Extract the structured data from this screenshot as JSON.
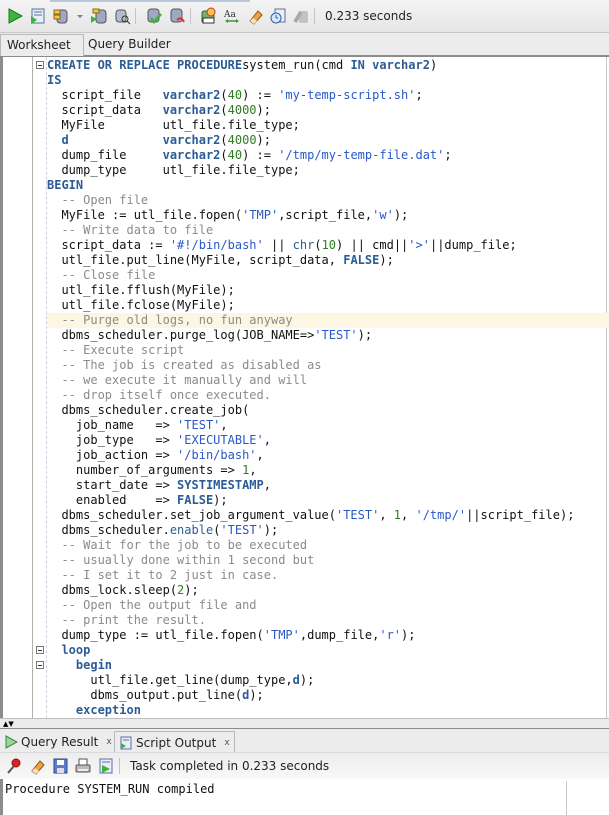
{
  "toolbar": {
    "status": "0.233 seconds",
    "icons": [
      "run-statement-icon",
      "run-script-icon",
      "commit-icon",
      "dropdown-icon",
      "autotrace-icon",
      "explain-plan-icon",
      "commit-transaction-icon",
      "rollback-icon",
      "sql-tuning-icon",
      "format-icon",
      "clear-icon",
      "history-icon",
      "unshared-icon"
    ]
  },
  "tabs": [
    {
      "label": "Worksheet",
      "active": true
    },
    {
      "label": "Query Builder",
      "active": false
    }
  ],
  "colors": {
    "keyword": "#2b5c96",
    "string": "#2a58c6",
    "number": "#2e7d20",
    "comment": "#8b8b8b",
    "highlight_line": "#fdf6e3"
  },
  "code_lines": [
    [
      [
        "kw",
        "CREATE OR REPLACE PROCEDURE"
      ],
      [
        "",
        "system_run(cmd "
      ],
      [
        "kw",
        "IN"
      ],
      [
        "",
        ""
      ],
      [
        "kw",
        " varchar2"
      ],
      [
        "",
        ")"
      ]
    ],
    [
      [
        "kw",
        "IS"
      ]
    ],
    [
      [
        "",
        "  script_file   "
      ],
      [
        "kw",
        "varchar2"
      ],
      [
        "",
        "("
      ],
      [
        "nu",
        "40"
      ],
      [
        "",
        ") := "
      ],
      [
        "st",
        "'my-temp-script.sh'"
      ],
      [
        "",
        ";"
      ]
    ],
    [
      [
        "",
        "  script_data   "
      ],
      [
        "kw",
        "varchar2"
      ],
      [
        "",
        "("
      ],
      [
        "nu",
        "4000"
      ],
      [
        "",
        ");"
      ]
    ],
    [
      [
        "",
        "  MyFile        utl_file.file_type;"
      ]
    ],
    [
      [
        "",
        "  "
      ],
      [
        "kw",
        "d"
      ],
      [
        "",
        "             "
      ],
      [
        "kw",
        "varchar2"
      ],
      [
        "",
        "("
      ],
      [
        "nu",
        "4000"
      ],
      [
        "",
        ");"
      ]
    ],
    [
      [
        "",
        "  dump_file     "
      ],
      [
        "kw",
        "varchar2"
      ],
      [
        "",
        "("
      ],
      [
        "nu",
        "40"
      ],
      [
        "",
        ") := "
      ],
      [
        "st",
        "'/tmp/my-temp-file.dat'"
      ],
      [
        "",
        ";"
      ]
    ],
    [
      [
        "",
        "  dump_type     utl_file.file_type;"
      ]
    ],
    [
      [
        "kw",
        "BEGIN"
      ]
    ],
    [
      [
        "cm",
        "  -- Open file"
      ]
    ],
    [
      [
        "",
        "  MyFile := utl_file.fopen("
      ],
      [
        "st",
        "'TMP'"
      ],
      [
        "",
        ",script_file,"
      ],
      [
        "st",
        "'w'"
      ],
      [
        "",
        ");"
      ]
    ],
    [
      [
        "cm",
        "  -- Write data to file"
      ]
    ],
    [
      [
        "",
        "  script_data := "
      ],
      [
        "st",
        "'#!/bin/bash'"
      ],
      [
        "",
        " || "
      ],
      [
        "fn",
        "chr"
      ],
      [
        "",
        "("
      ],
      [
        "nu",
        "10"
      ],
      [
        "",
        ") || cmd||"
      ],
      [
        "st",
        "'>'"
      ],
      [
        "",
        "||dump_file;"
      ]
    ],
    [
      [
        "",
        "  utl_file.put_line(MyFile, script_data, "
      ],
      [
        "kw",
        "FALSE"
      ],
      [
        "",
        ");"
      ]
    ],
    [
      [
        "cm",
        "  -- Close file"
      ]
    ],
    [
      [
        "",
        "  utl_file.fflush(MyFile);"
      ]
    ],
    [
      [
        "",
        "  utl_file.fclose(MyFile);"
      ]
    ],
    [
      [
        "cm",
        "  -- Purge old logs, no fun anyway"
      ]
    ],
    [
      [
        "",
        "  dbms_scheduler.purge_log(JOB_NAME=>"
      ],
      [
        "st",
        "'TEST'"
      ],
      [
        "",
        ");"
      ]
    ],
    [
      [
        "cm",
        "  -- Execute script"
      ]
    ],
    [
      [
        "cm",
        "  -- The job is created as disabled as"
      ]
    ],
    [
      [
        "cm",
        "  -- we execute it manually and will"
      ]
    ],
    [
      [
        "cm",
        "  -- drop itself once executed."
      ]
    ],
    [
      [
        "",
        "  dbms_scheduler.create_job("
      ]
    ],
    [
      [
        "",
        "    job_name   => "
      ],
      [
        "st",
        "'TEST'"
      ],
      [
        "",
        ","
      ]
    ],
    [
      [
        "",
        "    job_type   => "
      ],
      [
        "st",
        "'EXECUTABLE'"
      ],
      [
        "",
        ","
      ]
    ],
    [
      [
        "",
        "    job_action => "
      ],
      [
        "st",
        "'/bin/bash'"
      ],
      [
        "",
        ","
      ]
    ],
    [
      [
        "",
        "    number_of_arguments => "
      ],
      [
        "nu",
        "1"
      ],
      [
        "",
        ","
      ]
    ],
    [
      [
        "",
        "    start_date => "
      ],
      [
        "kw",
        "SYSTIMESTAMP"
      ],
      [
        "",
        ","
      ]
    ],
    [
      [
        "",
        "    enabled    => "
      ],
      [
        "kw",
        "FALSE"
      ],
      [
        "",
        ");"
      ]
    ],
    [
      [
        "",
        "  dbms_scheduler.set_job_argument_value("
      ],
      [
        "st",
        "'TEST'"
      ],
      [
        "",
        ", "
      ],
      [
        "nu",
        "1"
      ],
      [
        "",
        ", "
      ],
      [
        "st",
        "'/tmp/'"
      ],
      [
        "",
        "||script_file);"
      ]
    ],
    [
      [
        "",
        "  dbms_scheduler."
      ],
      [
        "fn",
        "enable"
      ],
      [
        "",
        "("
      ],
      [
        "st",
        "'TEST'"
      ],
      [
        "",
        ");"
      ]
    ],
    [
      [
        "cm",
        "  -- Wait for the job to be executed"
      ]
    ],
    [
      [
        "cm",
        "  -- usually done within 1 second but"
      ]
    ],
    [
      [
        "cm",
        "  -- I set it to 2 just in case."
      ]
    ],
    [
      [
        "",
        "  dbms_lock.sleep("
      ],
      [
        "nu",
        "2"
      ],
      [
        "",
        ");"
      ]
    ],
    [
      [
        "cm",
        "  -- Open the output file and"
      ]
    ],
    [
      [
        "cm",
        "  -- print the result."
      ]
    ],
    [
      [
        "",
        "  dump_type := utl_file.fopen("
      ],
      [
        "st",
        "'TMP'"
      ],
      [
        "",
        ",dump_file,"
      ],
      [
        "st",
        "'r'"
      ],
      [
        "",
        ");"
      ]
    ],
    [
      [
        "kw",
        "  loop"
      ]
    ],
    [
      [
        "kw",
        "    begin"
      ]
    ],
    [
      [
        "",
        "      utl_file.get_line(dump_type,"
      ],
      [
        "kw",
        "d"
      ],
      [
        "",
        ");"
      ]
    ],
    [
      [
        "",
        "      dbms_output.put_line("
      ],
      [
        "kw",
        "d"
      ],
      [
        "",
        ");"
      ]
    ],
    [
      [
        "kw",
        "    exception"
      ]
    ]
  ],
  "highlighted_line": 17,
  "fold_lines": [
    0,
    39,
    40
  ],
  "bottom_tabs": [
    {
      "label": "Query Result",
      "close": "x",
      "active": false
    },
    {
      "label": "Script Output",
      "close": "x",
      "active": true
    }
  ],
  "output_toolbar": {
    "icons": [
      "pin-icon",
      "clear-icon",
      "save-icon",
      "print-icon",
      "run-script-icon"
    ],
    "status": "Task completed in 0.233 seconds"
  },
  "output": {
    "text": "Procedure SYSTEM_RUN compiled"
  },
  "splitter": {
    "arrows": "▲▼"
  }
}
